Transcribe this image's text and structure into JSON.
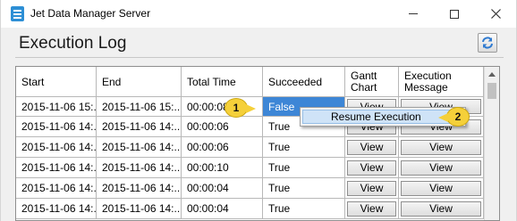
{
  "window": {
    "title": "Jet Data Manager Server"
  },
  "page": {
    "title": "Execution Log"
  },
  "columns": [
    "Start",
    "End",
    "Total Time",
    "Succeeded",
    "Gantt\nChart",
    "Execution\nMessage"
  ],
  "rows": [
    {
      "start": "2015-11-06 15:...",
      "end": "2015-11-06 15:...",
      "total": "00:00:08",
      "succeeded": "False",
      "gantt": "View",
      "message": "View"
    },
    {
      "start": "2015-11-06 14:...",
      "end": "2015-11-06 14:...",
      "total": "00:00:06",
      "succeeded": "True",
      "gantt": "View",
      "message": "View"
    },
    {
      "start": "2015-11-06 14:...",
      "end": "2015-11-06 14:...",
      "total": "00:00:06",
      "succeeded": "True",
      "gantt": "View",
      "message": "View"
    },
    {
      "start": "2015-11-06 14:...",
      "end": "2015-11-06 14:...",
      "total": "00:00:10",
      "succeeded": "True",
      "gantt": "View",
      "message": "View"
    },
    {
      "start": "2015-11-06 14:...",
      "end": "2015-11-06 14:...",
      "total": "00:00:04",
      "succeeded": "True",
      "gantt": "View",
      "message": "View"
    },
    {
      "start": "2015-11-06 14:...",
      "end": "2015-11-06 14:...",
      "total": "00:00:04",
      "succeeded": "True",
      "gantt": "View",
      "message": "View"
    }
  ],
  "context_menu": {
    "item": "Resume Execution"
  },
  "callouts": [
    "1",
    "2"
  ],
  "colors": {
    "selection": "#3d86d6",
    "callout": "#f5d03a",
    "menu_highlight": "#cfe3f7"
  },
  "icons": [
    "app-icon",
    "minimize-icon",
    "maximize-icon",
    "close-icon",
    "refresh-icon",
    "scroll-up-arrow-icon"
  ]
}
